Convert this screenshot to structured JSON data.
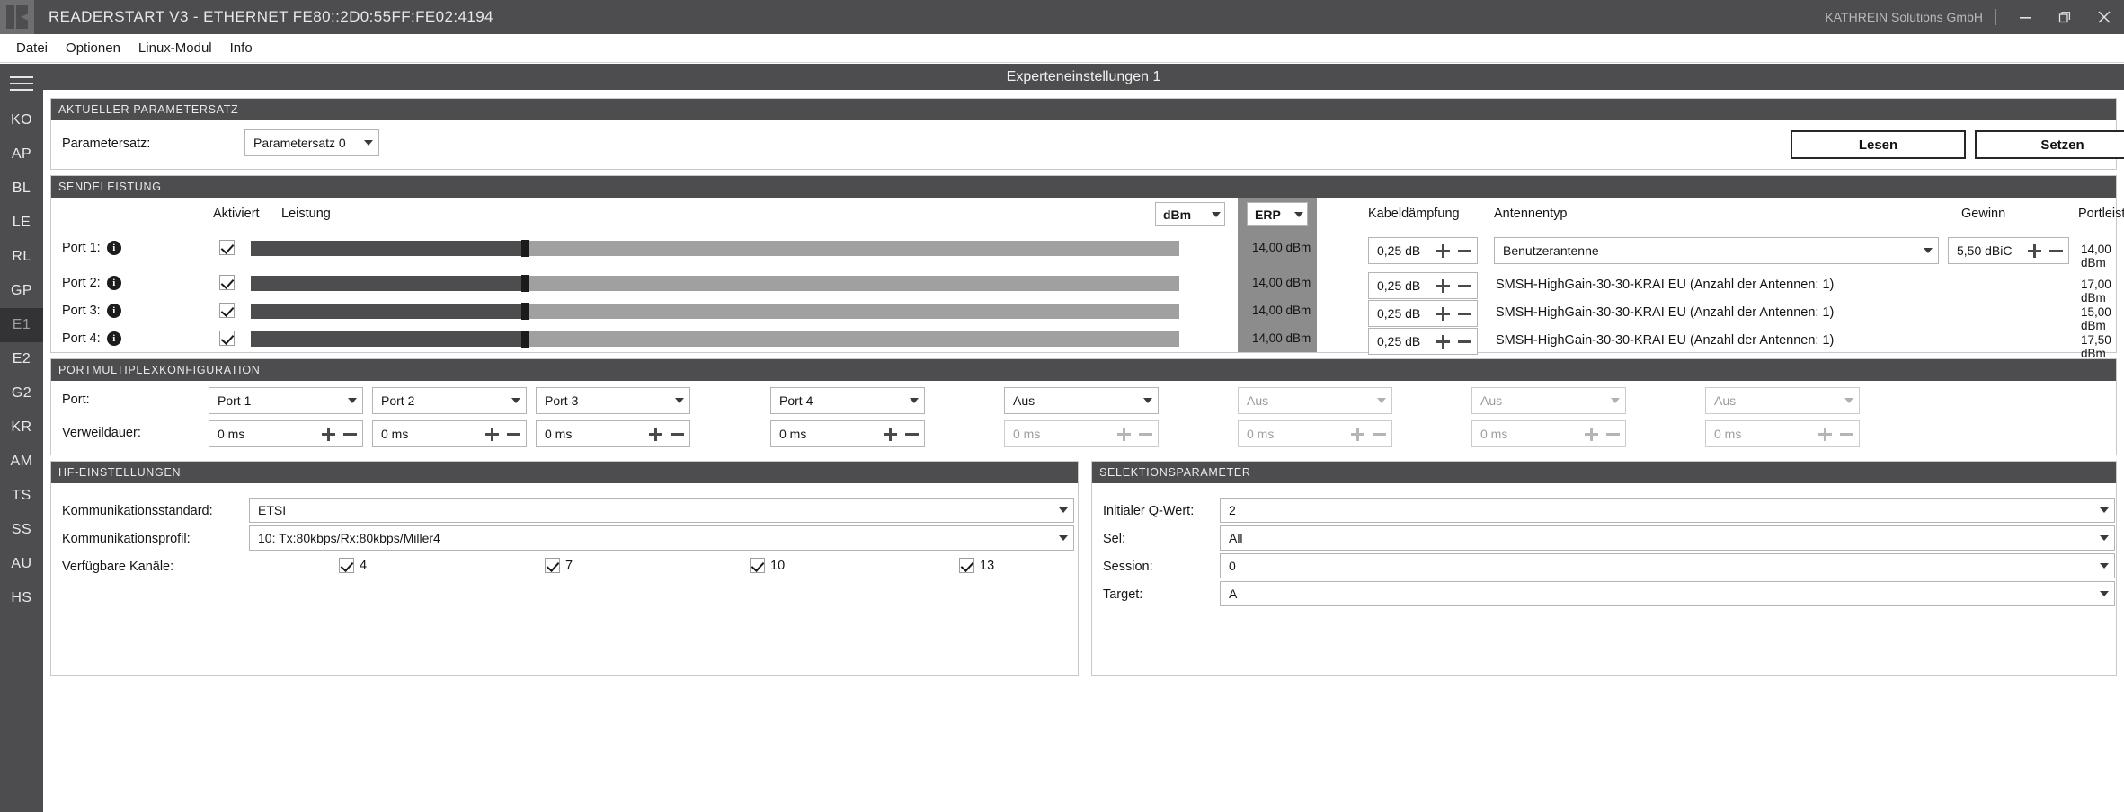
{
  "window": {
    "title": "READERSTART V3 - ETHERNET FE80::2D0:55FF:FE02:4194",
    "company": "KATHREIN Solutions GmbH",
    "minimize_icon": "minimize-icon",
    "restore_icon": "restore-icon",
    "close_icon": "close-icon"
  },
  "menu": {
    "items": [
      {
        "label": "Datei"
      },
      {
        "label": "Optionen"
      },
      {
        "label": "Linux-Modul"
      },
      {
        "label": "Info"
      }
    ]
  },
  "sidebar": {
    "menu_icon": "hamburger-icon",
    "items": [
      {
        "label": "KO",
        "active": false
      },
      {
        "label": "AP",
        "active": false
      },
      {
        "label": "BL",
        "active": false
      },
      {
        "label": "LE",
        "active": false
      },
      {
        "label": "RL",
        "active": false
      },
      {
        "label": "GP",
        "active": false
      },
      {
        "label": "E1",
        "active": true
      },
      {
        "label": "E2",
        "active": false
      },
      {
        "label": "G2",
        "active": false
      },
      {
        "label": "KR",
        "active": false
      },
      {
        "label": "AM",
        "active": false
      },
      {
        "label": "TS",
        "active": false
      },
      {
        "label": "SS",
        "active": false
      },
      {
        "label": "AU",
        "active": false
      },
      {
        "label": "HS",
        "active": false
      }
    ]
  },
  "page": {
    "title": "Experteneinstellungen 1"
  },
  "parameterset": {
    "group_title": "AKTUELLER PARAMETERSATZ",
    "label": "Parametersatz:",
    "value": "Parametersatz 0",
    "read_button": "Lesen",
    "set_button": "Setzen"
  },
  "sendeleistung": {
    "group_title": "SENDELEISTUNG",
    "headers": {
      "aktiviert": "Aktiviert",
      "leistung": "Leistung",
      "unit": "dBm",
      "erp": "ERP",
      "kabeldaempfung": "Kabeldämpfung",
      "antennentyp": "Antennentyp",
      "gewinn": "Gewinn",
      "portleistung": "Portleistung"
    },
    "ports": [
      {
        "label": "Port 1:",
        "enabled": true,
        "slider_percent": 29.5,
        "power": "14,00 dBm",
        "cable_loss": "0,25 dB",
        "antenna": "Benutzerantenne",
        "antenna_is_combo": true,
        "gain": "5,50 dBiC",
        "gain_visible": true,
        "port_power": "14,00 dBm"
      },
      {
        "label": "Port 2:",
        "enabled": true,
        "slider_percent": 29.5,
        "power": "14,00 dBm",
        "cable_loss": "0,25 dB",
        "antenna": "SMSH-HighGain-30-30-KRAI EU (Anzahl der Antennen: 1)",
        "antenna_is_combo": false,
        "gain": "",
        "gain_visible": false,
        "port_power": "17,00 dBm"
      },
      {
        "label": "Port 3:",
        "enabled": true,
        "slider_percent": 29.5,
        "power": "14,00 dBm",
        "cable_loss": "0,25 dB",
        "antenna": "SMSH-HighGain-30-30-KRAI EU (Anzahl der Antennen: 1)",
        "antenna_is_combo": false,
        "gain": "",
        "gain_visible": false,
        "port_power": "15,00 dBm"
      },
      {
        "label": "Port 4:",
        "enabled": true,
        "slider_percent": 29.5,
        "power": "14,00 dBm",
        "cable_loss": "0,25 dB",
        "antenna": "SMSH-HighGain-30-30-KRAI EU (Anzahl der Antennen: 1)",
        "antenna_is_combo": false,
        "gain": "",
        "gain_visible": false,
        "port_power": "17,50 dBm"
      }
    ]
  },
  "portmultiplex": {
    "group_title": "PORTMULTIPLEXKONFIGURATION",
    "port_label": "Port:",
    "dwell_label": "Verweildauer:",
    "columns": [
      {
        "port": "Port 1",
        "dwell": "0 ms",
        "disabled": false
      },
      {
        "port": "Port 2",
        "dwell": "0 ms",
        "disabled": false
      },
      {
        "port": "Port 3",
        "dwell": "0 ms",
        "disabled": false
      },
      {
        "port": "Port 4",
        "dwell": "0 ms",
        "disabled": false
      },
      {
        "port": "Aus",
        "dwell": "0 ms",
        "disabled": false
      },
      {
        "port": "Aus",
        "dwell": "0 ms",
        "disabled": true
      },
      {
        "port": "Aus",
        "dwell": "0 ms",
        "disabled": true
      },
      {
        "port": "Aus",
        "dwell": "0 ms",
        "disabled": true
      }
    ]
  },
  "hf": {
    "group_title": "HF-EINSTELLUNGEN",
    "standard_label": "Kommunikationsstandard:",
    "standard_value": "ETSI",
    "profile_label": "Kommunikationsprofil:",
    "profile_value": "10: Tx:80kbps/Rx:80kbps/Miller4",
    "channels_label": "Verfügbare Kanäle:",
    "channels": [
      {
        "label": "4",
        "checked": true
      },
      {
        "label": "7",
        "checked": true
      },
      {
        "label": "10",
        "checked": true
      },
      {
        "label": "13",
        "checked": true
      }
    ]
  },
  "selection": {
    "group_title": "SELEKTIONSPARAMETER",
    "rows": [
      {
        "label": "Initialer Q-Wert:",
        "value": "2"
      },
      {
        "label": "Sel:",
        "value": "All"
      },
      {
        "label": "Session:",
        "value": "0"
      },
      {
        "label": "Target:",
        "value": "A"
      }
    ]
  },
  "colors": {
    "chrome_dark": "#4d4d4f",
    "band_grey": "#8c8c8c",
    "slider_track": "#a0a0a0",
    "slider_fill": "#4d4d4f"
  }
}
